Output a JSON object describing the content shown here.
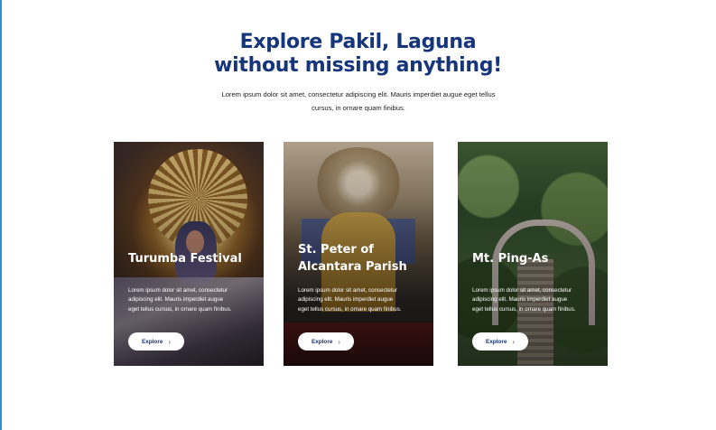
{
  "header": {
    "title_line1": "Explore Pakil, Laguna",
    "title_line2": "without missing anything!",
    "intro": "Lorem ipsum dolor sit amet, consectetur adipiscing elit. Mauris imperdiet augue eget tellus cursus, in ornare quam finibus."
  },
  "cards": [
    {
      "title": "Turumba Festival",
      "text": "Lorem ipsum dolor sit amet, consectetur adipiscing elit. Mauris imperdiet augue eget tellus cursus, in ornare quam finibus.",
      "button": "Explore",
      "button_icon": "chevron-right-icon"
    },
    {
      "title": "St. Peter of Alcantara Parish",
      "text": "Lorem ipsum dolor sit amet, consectetur adipiscing elit. Mauris imperdiet augue eget tellus cursus, in ornare quam finibus.",
      "button": "Explore",
      "button_icon": "chevron-right-icon"
    },
    {
      "title": "Mt. Ping-As",
      "text": "Lorem ipsum dolor sit amet, consectetur adipiscing elit. Mauris imperdiet augue eget tellus cursus, in ornare quam finibus.",
      "button": "Explore",
      "button_icon": "chevron-right-icon"
    }
  ],
  "colors": {
    "heading": "#17357a",
    "button_text": "#17357a",
    "edge": "#2f8fd8"
  }
}
